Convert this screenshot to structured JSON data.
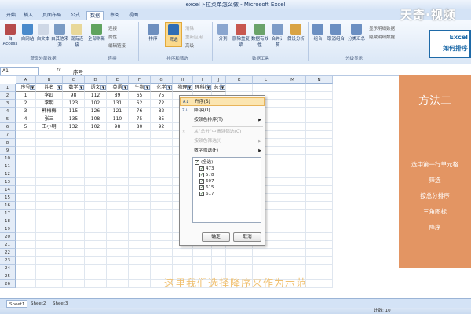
{
  "window": {
    "title": "excel下拉菜单怎么做 - Microsoft Excel"
  },
  "ribbon_tabs": [
    "开始",
    "插入",
    "页面布局",
    "公式",
    "数据",
    "审阅",
    "视图"
  ],
  "ribbon": {
    "buttons": [
      "自Access",
      "自网站",
      "自文本",
      "自其他来源",
      "现有连接",
      "全部刷新",
      "排序",
      "筛选",
      "分列",
      "删除重复项",
      "数据有效性",
      "合并计算",
      "假设分析",
      "组合",
      "取消组合",
      "分类汇总"
    ],
    "small_items": [
      "连接",
      "属性",
      "编辑链接",
      "清除",
      "重新应用",
      "高级",
      "显示明细数据",
      "隐藏明细数据"
    ],
    "groups": [
      "获取外部数据",
      "连接",
      "排序和筛选",
      "数据工具",
      "分级显示"
    ]
  },
  "formula_bar": {
    "name_box": "A1",
    "fx": "fx",
    "content": "序号"
  },
  "grid": {
    "col_letters": [
      "A",
      "B",
      "C",
      "D",
      "E",
      "F",
      "G",
      "H",
      "I",
      "J",
      "K",
      "L",
      "M",
      "N"
    ],
    "headers": [
      "序号",
      "姓名",
      "数学",
      "语文",
      "英语",
      "生物",
      "化学",
      "物理",
      "理科综",
      "总分"
    ],
    "rows": [
      [
        "1",
        "李四",
        "98",
        "112",
        "89",
        "65",
        "75",
        "",
        "",
        ""
      ],
      [
        "2",
        "李明",
        "123",
        "102",
        "131",
        "62",
        "72",
        "",
        "",
        ""
      ],
      [
        "3",
        "韩梅梅",
        "115",
        "126",
        "121",
        "76",
        "82",
        "",
        "",
        ""
      ],
      [
        "4",
        "张三",
        "135",
        "108",
        "110",
        "75",
        "85",
        "",
        "",
        ""
      ],
      [
        "5",
        "王小明",
        "132",
        "102",
        "98",
        "80",
        "92",
        "",
        "",
        ""
      ]
    ],
    "row_numbers": [
      "1",
      "2",
      "3",
      "4",
      "5",
      "6",
      "7",
      "8",
      "9",
      "10",
      "11",
      "12",
      "13",
      "14",
      "15",
      "16",
      "17",
      "18",
      "19",
      "20",
      "21",
      "22",
      "23",
      "24",
      "25",
      "26"
    ]
  },
  "filter_menu": {
    "items": [
      {
        "label": "升序(S)",
        "icon": "sort-asc-icon",
        "state": "highlighted"
      },
      {
        "label": "降序(O)",
        "icon": "sort-desc-icon",
        "state": "normal"
      },
      {
        "label": "按颜色排序(T)",
        "icon": "",
        "state": "normal",
        "submenu": true
      },
      {
        "label": "从\"总分\"中清除筛选(C)",
        "icon": "clear-filter-icon",
        "state": "disabled"
      },
      {
        "label": "按颜色筛选(I)",
        "icon": "",
        "state": "disabled",
        "submenu": true
      },
      {
        "label": "数字筛选(F)",
        "icon": "",
        "state": "normal",
        "submenu": true
      }
    ],
    "checklist": [
      {
        "label": "(全选)",
        "checked": true
      },
      {
        "label": "473",
        "checked": true
      },
      {
        "label": "578",
        "checked": true
      },
      {
        "label": "607",
        "checked": true
      },
      {
        "label": "615",
        "checked": true
      },
      {
        "label": "617",
        "checked": true
      }
    ],
    "ok_label": "确定",
    "cancel_label": "取消"
  },
  "overlay": {
    "logo": "天奇·视频",
    "badge_line1": "Excel",
    "badge_line2": "如何排序",
    "panel_title": "方法二",
    "panel_steps": [
      "选中第一行单元格",
      "筛选",
      "按总分排序",
      "三角图标",
      "降序"
    ],
    "subtitle": "这里我们选择降序来作为示范"
  },
  "sheet_tabs": [
    "Sheet1",
    "Sheet2",
    "Sheet3"
  ],
  "status_bar": {
    "count": "计数: 10"
  },
  "colors": {
    "accent": "#e39563",
    "ribbon": "#dbe7f6",
    "highlight": "#fbe5b1",
    "arrow": "#d8231e"
  }
}
